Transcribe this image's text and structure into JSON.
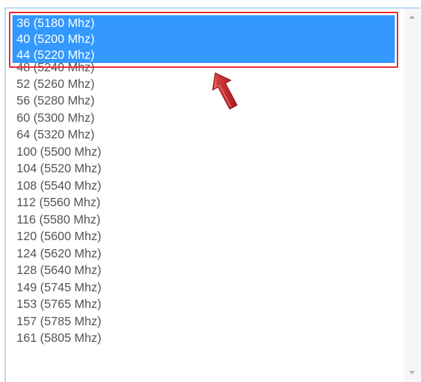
{
  "listbox": {
    "options": [
      "36 (5180 Mhz)",
      "40 (5200 Mhz)",
      "44 (5220 Mhz)",
      "48 (5240 Mhz)",
      "52 (5260 Mhz)",
      "56 (5280 Mhz)",
      "60 (5300 Mhz)",
      "64 (5320 Mhz)",
      "100 (5500 Mhz)",
      "104 (5520 Mhz)",
      "108 (5540 Mhz)",
      "112 (5560 Mhz)",
      "116 (5580 Mhz)",
      "120 (5600 Mhz)",
      "124 (5620 Mhz)",
      "128 (5640 Mhz)",
      "149 (5745 Mhz)",
      "153 (5765 Mhz)",
      "157 (5785 Mhz)",
      "161 (5805 Mhz)"
    ],
    "selected": [
      "36 (5180 Mhz)",
      "40 (5200 Mhz)",
      "44 (5220 Mhz)"
    ]
  },
  "colors": {
    "selection_bg": "#3399ff",
    "selection_text": "#ffffff",
    "option_text": "#555555",
    "highlight_border": "#e8202a",
    "annotation_arrow": "#c0262b",
    "listbox_border": "#7eb4ea"
  },
  "icons": {
    "annotation": "red-arrow-up-icon",
    "scroll_up": "triangle-up-icon",
    "scroll_down": "triangle-down-icon"
  }
}
